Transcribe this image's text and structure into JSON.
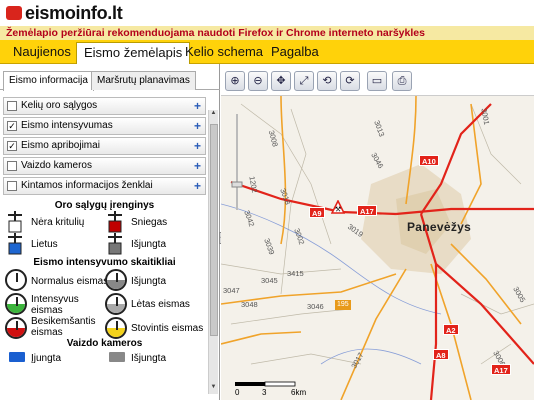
{
  "header": {
    "logo_text": "eismoinfo.lt"
  },
  "notice": {
    "text": "Žemėlapio peržiūrai rekomenduojama naudoti Firefox ir Chrome interneto naršykles"
  },
  "nav": {
    "tabs": [
      {
        "label": "Naujienos"
      },
      {
        "label": "Eismo žemėlapis"
      },
      {
        "label": "Kelio schema"
      },
      {
        "label": "Pagalba"
      }
    ]
  },
  "panel": {
    "tabs": [
      {
        "label": "Eismo informacija"
      },
      {
        "label": "Maršrutų planavimas"
      }
    ],
    "layers": [
      {
        "label": "Kelių oro sąlygos",
        "checked": false
      },
      {
        "label": "Eismo intensyvumas",
        "checked": true
      },
      {
        "label": "Eismo apribojimai",
        "checked": true
      },
      {
        "label": "Vaizdo kameros",
        "checked": false
      },
      {
        "label": "Kintamos informacijos ženklai",
        "checked": false
      }
    ],
    "legend": {
      "weather_title": "Oro sąlygų įrenginys",
      "weather": [
        "Nėra kritulių",
        "Sniegas",
        "Lietus",
        "Išjungta"
      ],
      "intensity_title": "Eismo intensyvumo skaitikliai",
      "intensity": [
        "Normalus eismas",
        "Išjungta",
        "Intensyvus eismas",
        "Lėtas eismas",
        "Besikemšantis eismas",
        "Stovintis eismas"
      ],
      "cameras_title": "Vaizdo kameros",
      "cameras": [
        "Įjungta",
        "Išjungta"
      ]
    }
  },
  "map": {
    "tools": [
      "zoom-in",
      "zoom-out",
      "pan",
      "zoom-extent",
      "previous-view",
      "next-view",
      "measure",
      "print"
    ],
    "town": "Panevėžys",
    "road_badges": [
      "A10",
      "A9",
      "A17",
      "A2",
      "A8",
      "A17"
    ],
    "route_numbers": [
      "3008",
      "3013",
      "3046",
      "3001",
      "1202",
      "3018",
      "3042",
      "3019",
      "3002",
      "3039",
      "3415",
      "3045",
      "3047",
      "3048",
      "3046",
      "195",
      "3017",
      "3006",
      "3005"
    ],
    "scale": {
      "ticks": [
        "0",
        "3",
        "6km"
      ]
    }
  },
  "colors": {
    "accent": "#ffd20a",
    "notice_text": "#b3001b",
    "road": "#e2231a",
    "link": "#2a5cb8"
  }
}
